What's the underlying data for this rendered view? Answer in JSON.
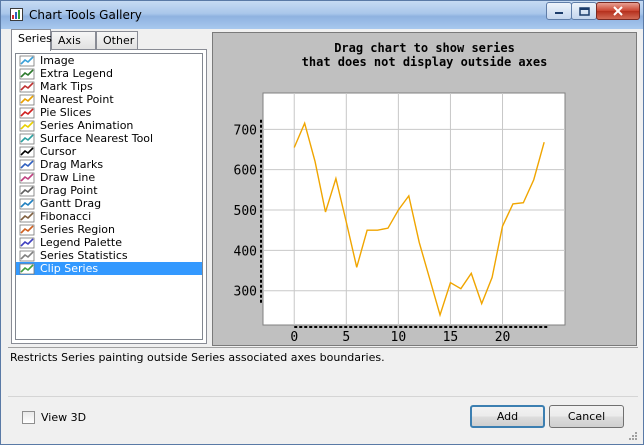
{
  "window": {
    "title": "Chart Tools Gallery",
    "controls": {
      "minimize_icon": "minimize-icon",
      "maximize_icon": "maximize-icon",
      "close_icon": "close-icon"
    }
  },
  "tabs": [
    {
      "label": "Series",
      "active": true
    },
    {
      "label": "Axis",
      "active": false
    },
    {
      "label": "Other",
      "active": false
    }
  ],
  "tools": [
    {
      "label": "Image",
      "icon": "image-icon"
    },
    {
      "label": "Extra Legend",
      "icon": "extra-legend-icon"
    },
    {
      "label": "Mark Tips",
      "icon": "mark-tips-icon"
    },
    {
      "label": "Nearest Point",
      "icon": "nearest-point-icon"
    },
    {
      "label": "Pie Slices",
      "icon": "pie-slices-icon"
    },
    {
      "label": "Series Animation",
      "icon": "series-animation-icon"
    },
    {
      "label": "Surface Nearest Tool",
      "icon": "surface-nearest-icon"
    },
    {
      "label": "Cursor",
      "icon": "cursor-icon"
    },
    {
      "label": "Drag Marks",
      "icon": "drag-marks-icon"
    },
    {
      "label": "Draw Line",
      "icon": "draw-line-icon"
    },
    {
      "label": "Drag Point",
      "icon": "drag-point-icon"
    },
    {
      "label": "Gantt Drag",
      "icon": "gantt-drag-icon"
    },
    {
      "label": "Fibonacci",
      "icon": "fibonacci-icon"
    },
    {
      "label": "Series Region",
      "icon": "series-region-icon"
    },
    {
      "label": "Legend Palette",
      "icon": "legend-palette-icon"
    },
    {
      "label": "Series Statistics",
      "icon": "series-statistics-icon"
    },
    {
      "label": "Clip Series",
      "icon": "clip-series-icon",
      "selected": true
    }
  ],
  "chart_data": {
    "type": "line",
    "title": [
      "Drag chart to show series",
      "that does not display outside axes"
    ],
    "x": [
      0,
      1,
      2,
      3,
      4,
      5,
      6,
      7,
      8,
      9,
      10,
      11,
      12,
      13,
      14,
      15,
      16,
      17,
      18,
      19,
      20,
      21,
      22,
      23,
      24
    ],
    "series": [
      {
        "values": [
          655,
          715,
          620,
          495,
          578,
          470,
          358,
          450,
          450,
          455,
          500,
          535,
          420,
          330,
          240,
          320,
          305,
          343,
          268,
          333,
          460,
          515,
          518,
          575,
          668
        ],
        "color": "#f0a500"
      }
    ],
    "xticks": [
      0,
      5,
      10,
      15,
      20
    ],
    "yticks": [
      300,
      400,
      500,
      600,
      700
    ],
    "xlim": [
      -3,
      26
    ],
    "ylim": [
      215,
      790
    ],
    "grid": true
  },
  "description": "Restricts Series painting outside Series associated axes boundaries.",
  "view3d": {
    "label": "View 3D",
    "checked": false
  },
  "buttons": {
    "add": "Add",
    "cancel": "Cancel"
  }
}
